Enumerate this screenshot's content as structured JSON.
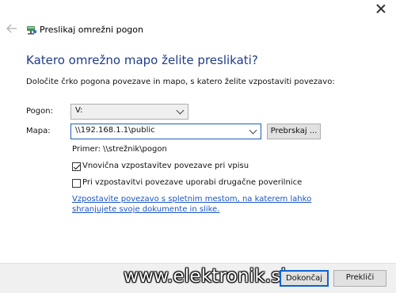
{
  "window": {
    "title": "Preslikaj omrežni pogon"
  },
  "main": {
    "heading": "Katero omrežno mapo želite preslikati?",
    "instructions": "Določite črko pogona povezave in mapo, s katero želite vzpostaviti povezavo:",
    "drive_label": "Pogon:",
    "drive_value": "V:",
    "folder_label": "Mapa:",
    "folder_value": "\\\\192.168.1.1\\public",
    "browse_label": "Prebrskaj ...",
    "example": "Primer: \\\\strežnik\\pogon",
    "reconnect_label": "Vnovična vzpostavitev povezave pri vpisu",
    "reconnect_checked": true,
    "different_credentials_label": "Pri vzpostavitvi povezave uporabi drugačne poverilnice",
    "different_credentials_checked": false,
    "link": "Vzpostavite povezavo s spletnim mestom, na katerem lahko shranjujete svoje dokumente in slike."
  },
  "footer": {
    "finish_label": "Dokončaj",
    "cancel_label": "Prekliči"
  },
  "watermark": "www.elektronik.si",
  "icons": {
    "back": "back-arrow-icon",
    "network_drive": "network-drive-icon",
    "close": "close-icon"
  },
  "colors": {
    "heading": "#1f3c88",
    "link": "#1a55c4",
    "focus_border": "#0a64d1"
  }
}
